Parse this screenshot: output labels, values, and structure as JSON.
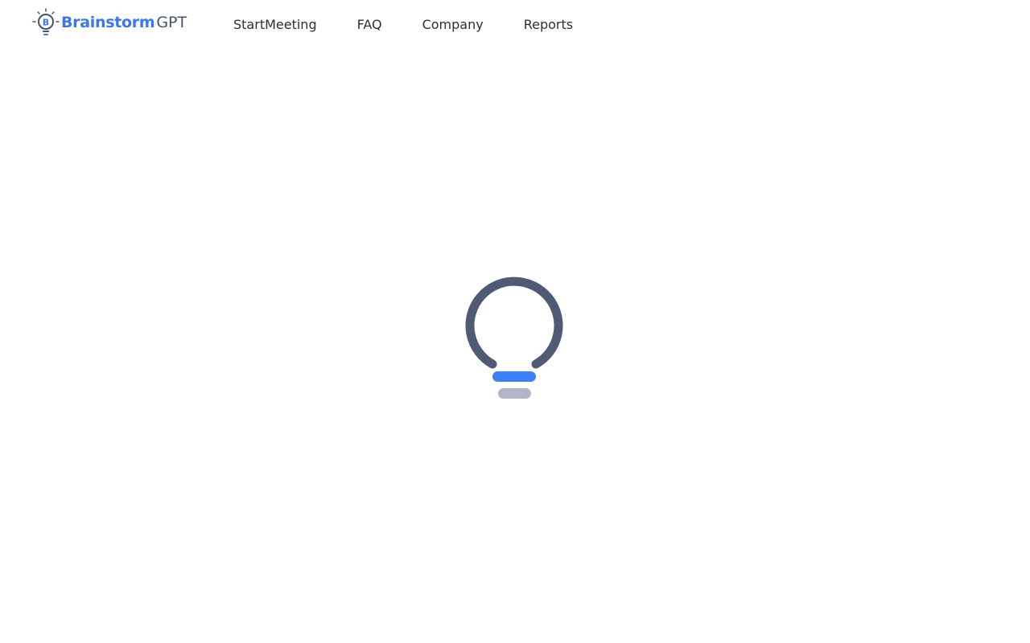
{
  "header": {
    "logo": {
      "primary": "Brainstorm",
      "secondary": "GPT",
      "icon": "lightbulb-b-icon",
      "icon_letter": "B"
    },
    "nav": [
      {
        "label": "StartMeeting"
      },
      {
        "label": "FAQ"
      },
      {
        "label": "Company"
      },
      {
        "label": "Reports"
      }
    ]
  },
  "loader": {
    "icon": "lightbulb-loading-icon"
  },
  "colors": {
    "brand_blue": "#3a78e8",
    "slate": "#475569",
    "bulb_ring": "#4f5b75",
    "bulb_base_top": "#3f80f5",
    "bulb_base_bottom": "#b1b5c4",
    "nav_text": "#2b2f36"
  }
}
